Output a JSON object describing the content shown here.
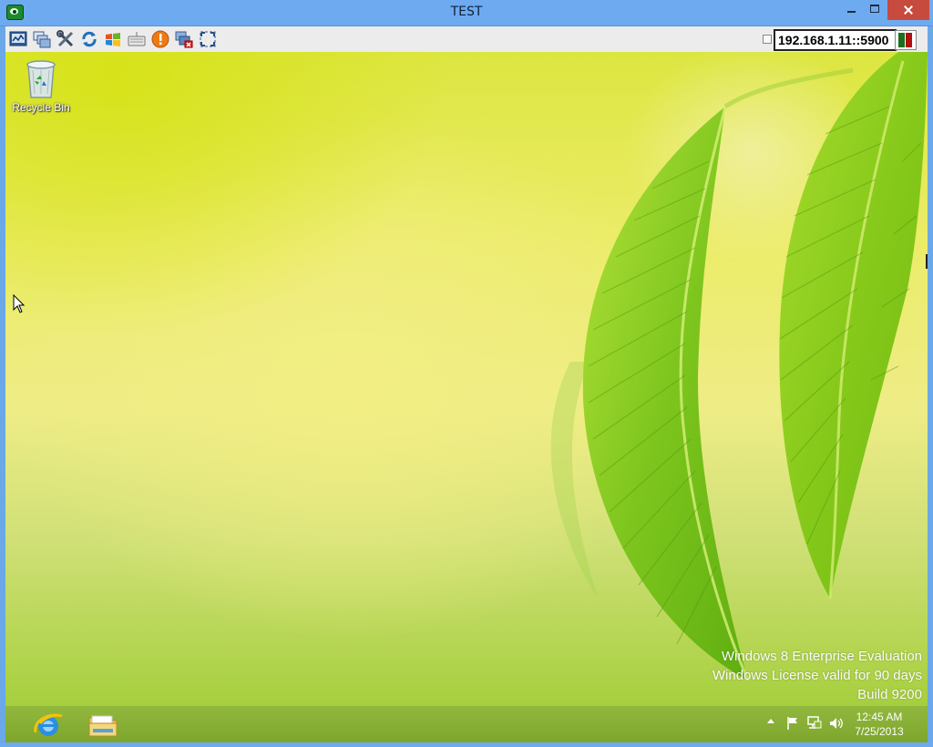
{
  "window": {
    "title": "TEST",
    "controls": {
      "minimize": "minimize",
      "maximize": "maximize",
      "close": "close"
    }
  },
  "toolbar": {
    "icons": [
      "connection-options-icon",
      "multi-window-icon",
      "tools-icon",
      "refresh-icon",
      "windows-key-icon",
      "keyboard-icon",
      "alert-icon",
      "disconnect-icon",
      "fullscreen-icon"
    ],
    "server": "192.168.1.11::5900",
    "status_colors": [
      "#1e6e1e",
      "#b01010"
    ]
  },
  "desktop": {
    "icons": [
      {
        "label": "Recycle Bin",
        "icon": "recycle-bin-icon"
      }
    ],
    "watermark": {
      "line1": "Windows 8 Enterprise Evaluation",
      "line2": "Windows License valid for 90 days",
      "line3": "Build 9200"
    }
  },
  "taskbar": {
    "apps": [
      {
        "name": "Internet Explorer",
        "icon": "internet-explorer-icon"
      },
      {
        "name": "File Explorer",
        "icon": "file-explorer-icon"
      }
    ],
    "tray_icons": [
      "show-hidden-icons",
      "action-center-flag-icon",
      "network-icon",
      "volume-icon"
    ],
    "clock": {
      "time": "12:45 AM",
      "date": "7/25/2013"
    }
  }
}
